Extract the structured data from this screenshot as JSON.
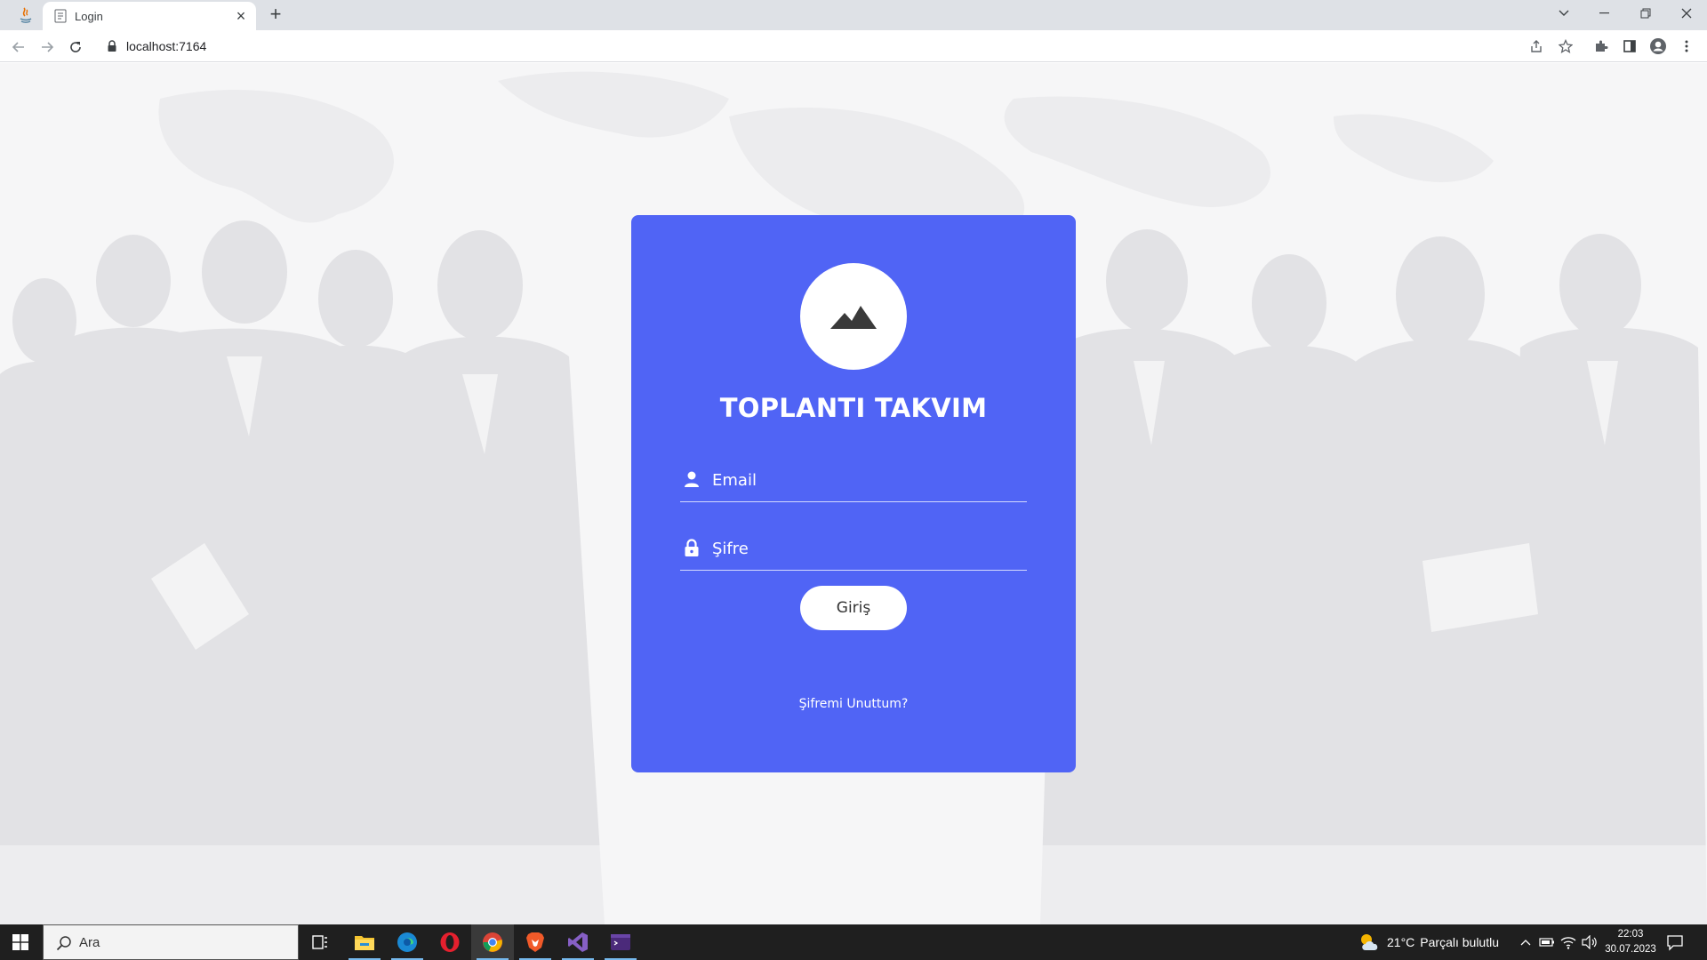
{
  "browser": {
    "tab_title": "Login",
    "url": "localhost:7164"
  },
  "login": {
    "title": "TOPLANTI TAKVIM",
    "email_placeholder": "Email",
    "password_placeholder": "Şifre",
    "submit_label": "Giriş",
    "forgot_label": "Şifremi Unuttum?"
  },
  "colors": {
    "card_background": "#5064f5",
    "page_background": "#f6f6f7",
    "taskbar_background": "#1f1f1f"
  },
  "taskbar": {
    "search_placeholder": "Ara",
    "apps": [
      "task-view-icon",
      "file-explorer-icon",
      "edge-icon",
      "opera-icon",
      "chrome-icon",
      "brave-icon",
      "visual-studio-icon",
      "terminal-icon"
    ],
    "weather_temp": "21°C",
    "weather_desc": "Parçalı bulutlu",
    "time": "22:03",
    "date": "30.07.2023"
  }
}
